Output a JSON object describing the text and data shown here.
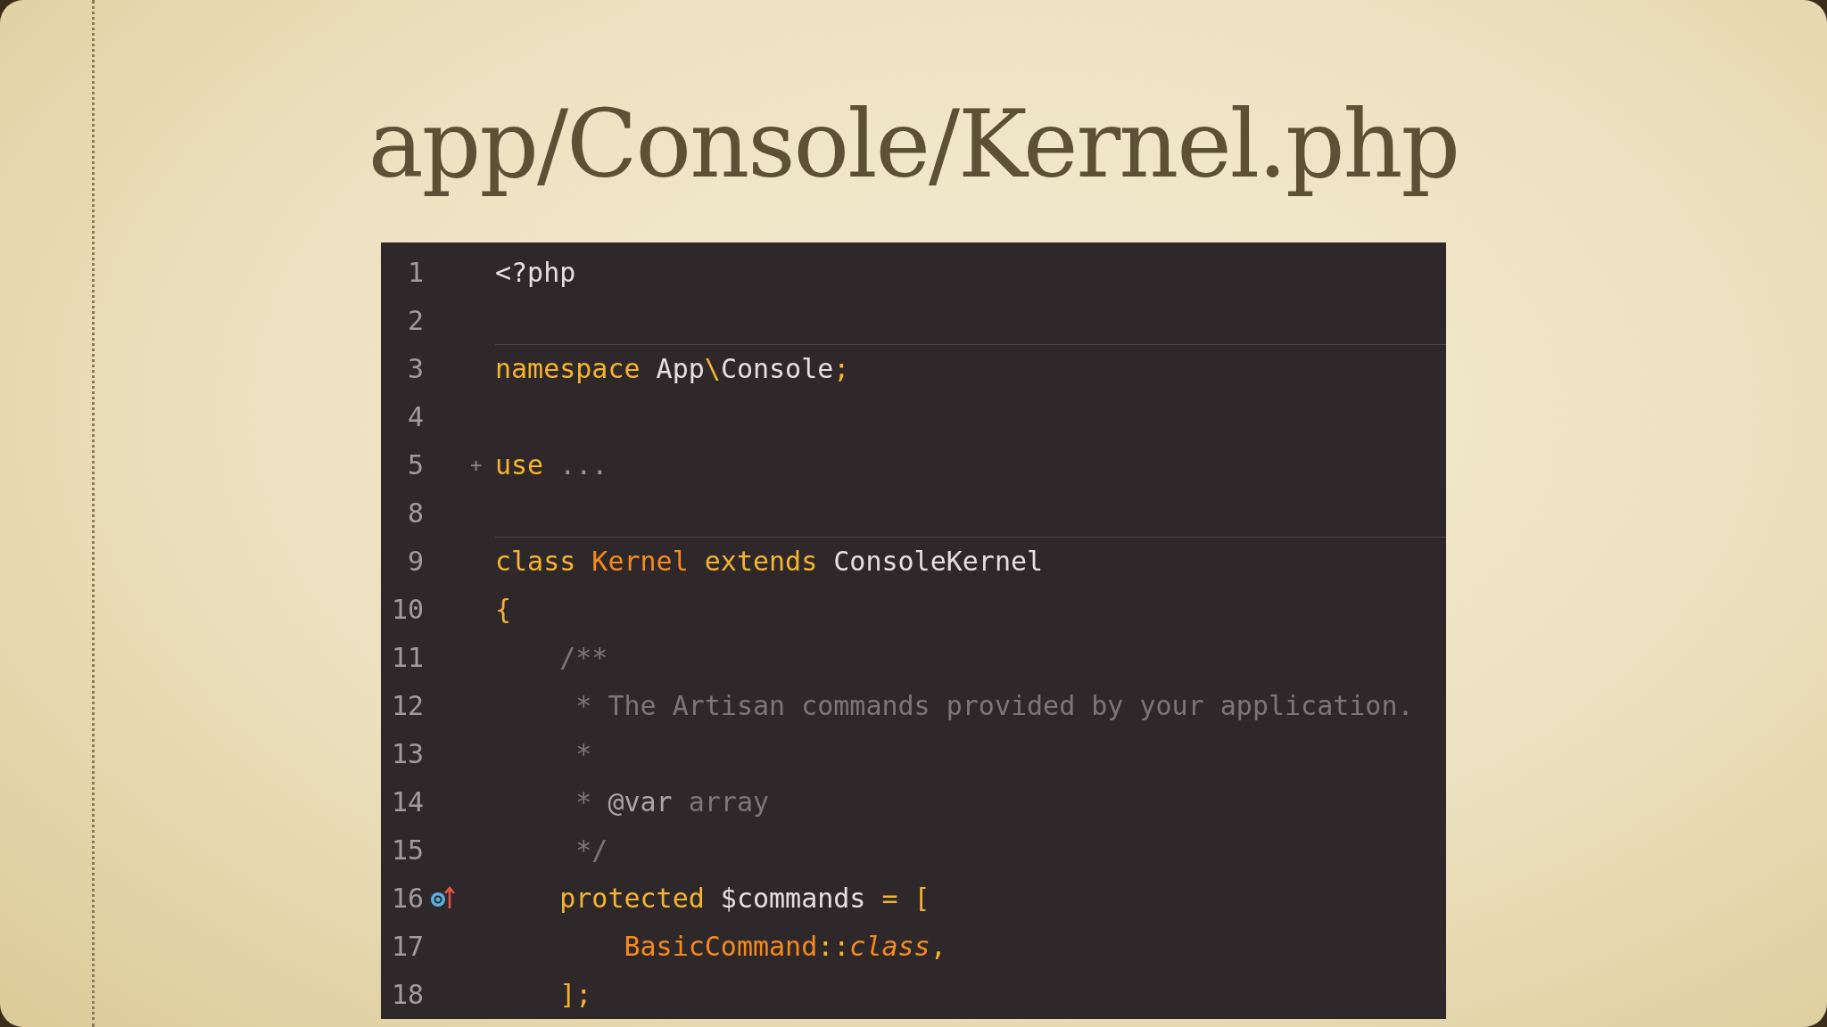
{
  "slide": {
    "title": "app/Console/Kernel.php"
  },
  "editor": {
    "lines": [
      {
        "number": "1",
        "separator_above": false,
        "segments": [
          {
            "text": "<?php",
            "kind": "plain"
          }
        ]
      },
      {
        "number": "2",
        "separator_above": false
      },
      {
        "number": "3",
        "separator_above": true,
        "segments": [
          {
            "text": "namespace",
            "kind": "keyword"
          },
          {
            "text": " App",
            "kind": "plain"
          },
          {
            "text": "\\",
            "kind": "keyword"
          },
          {
            "text": "Console",
            "kind": "plain"
          },
          {
            "text": ";",
            "kind": "keyword"
          }
        ]
      },
      {
        "number": "4",
        "separator_above": false
      },
      {
        "number": "5",
        "separator_above": false,
        "fold_mark": "+",
        "segments": [
          {
            "text": "use",
            "kind": "keyword"
          },
          {
            "text": " ...",
            "kind": "dim"
          }
        ]
      },
      {
        "number": "8",
        "separator_above": false
      },
      {
        "number": "9",
        "separator_above": true,
        "segments": [
          {
            "text": "class",
            "kind": "keyword"
          },
          {
            "text": " Kernel",
            "kind": "type"
          },
          {
            "text": " extends",
            "kind": "keyword"
          },
          {
            "text": " ConsoleKernel",
            "kind": "plain"
          }
        ]
      },
      {
        "number": "10",
        "separator_above": false,
        "segments": [
          {
            "text": "{",
            "kind": "keyword"
          }
        ]
      },
      {
        "number": "11",
        "separator_above": false,
        "segments": [
          {
            "text": "    /**",
            "kind": "comment"
          }
        ]
      },
      {
        "number": "12",
        "separator_above": false,
        "segments": [
          {
            "text": "     * The Artisan commands provided by your application.",
            "kind": "comment"
          }
        ]
      },
      {
        "number": "13",
        "separator_above": false,
        "segments": [
          {
            "text": "     *",
            "kind": "comment"
          }
        ]
      },
      {
        "number": "14",
        "separator_above": false,
        "segments": [
          {
            "text": "     * ",
            "kind": "comment"
          },
          {
            "text": "@var",
            "kind": "doctag"
          },
          {
            "text": " array",
            "kind": "comment"
          }
        ]
      },
      {
        "number": "15",
        "separator_above": false,
        "segments": [
          {
            "text": "     */",
            "kind": "comment"
          }
        ]
      },
      {
        "number": "16",
        "separator_above": false,
        "kind": "overriding",
        "segments": [
          {
            "text": "    protected",
            "kind": "keyword"
          },
          {
            "text": " $commands",
            "kind": "plain"
          },
          {
            "text": " = [",
            "kind": "keyword"
          }
        ]
      },
      {
        "number": "17",
        "separator_above": false,
        "segments": [
          {
            "text": "        BasicCommand",
            "kind": "type"
          },
          {
            "text": "::",
            "kind": "keyword"
          },
          {
            "text": "class",
            "kind": "type-italic"
          },
          {
            "text": ",",
            "kind": "keyword"
          }
        ]
      },
      {
        "number": "18",
        "separator_above": false,
        "segments": [
          {
            "text": "    ];",
            "kind": "keyword"
          }
        ]
      }
    ]
  }
}
